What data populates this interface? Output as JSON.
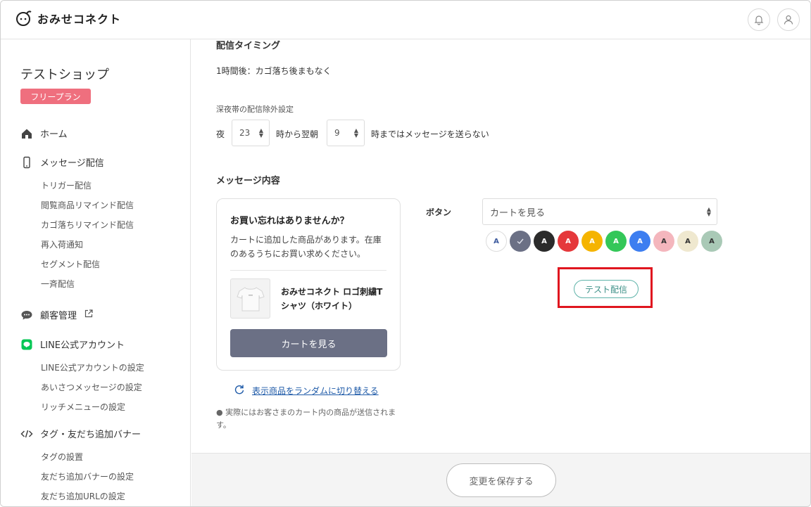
{
  "header": {
    "app_name": "おみせコネクト",
    "icons": [
      "logo-icon",
      "bell-icon",
      "user-icon"
    ]
  },
  "sidebar": {
    "shop_name": "テストショップ",
    "plan": "フリープラン",
    "home": "ホーム",
    "message": {
      "label": "メッセージ配信",
      "items": [
        "トリガー配信",
        "閲覧商品リマインド配信",
        "カゴ落ちリマインド配信",
        "再入荷通知",
        "セグメント配信",
        "一斉配信"
      ]
    },
    "customers": "顧客管理",
    "line": {
      "label": "LINE公式アカウント",
      "items": [
        "LINE公式アカウントの設定",
        "あいさつメッセージの設定",
        "リッチメニューの設定"
      ]
    },
    "tags": {
      "label": "タグ・友だち追加バナー",
      "items": [
        "タグの設置",
        "友だち追加バナーの設定",
        "友だち追加URLの設定"
      ]
    }
  },
  "main": {
    "timing_title": "配信タイミング",
    "timing_value": "1時間後：カゴ落ち後まもなく",
    "night_title": "深夜帯の配信除外設定",
    "night_prefix": "夜",
    "night_from": "23",
    "night_mid": "時から翌朝",
    "night_to": "9",
    "night_suffix": "時まではメッセージを送らない",
    "content_title": "メッセージ内容",
    "preview": {
      "title": "お買い忘れはありませんか？",
      "body": "カートに追加した商品があります。在庫のあるうちにお買い求めください。",
      "product": "おみせコネクト ロゴ刺繍Tシャツ（ホワイト）",
      "cart_button": "カートを見る"
    },
    "random_link": "表示商品をランダムに切り替える",
    "note": "● 実際にはお客さまのカート内の商品が送信されます。",
    "button_label": "ボタン",
    "button_select": "カートを見る",
    "swatch_letter": "A",
    "swatch_colors": [
      "#ffffff",
      "#6b7085",
      "#2b2b2b",
      "#e5383b",
      "#f5b400",
      "#34c759",
      "#3d7ef0",
      "#f4b6bd",
      "#efe8cf",
      "#a9c9b6"
    ],
    "test_button": "テスト配信"
  },
  "footer": {
    "save_button": "変更を保存する"
  }
}
